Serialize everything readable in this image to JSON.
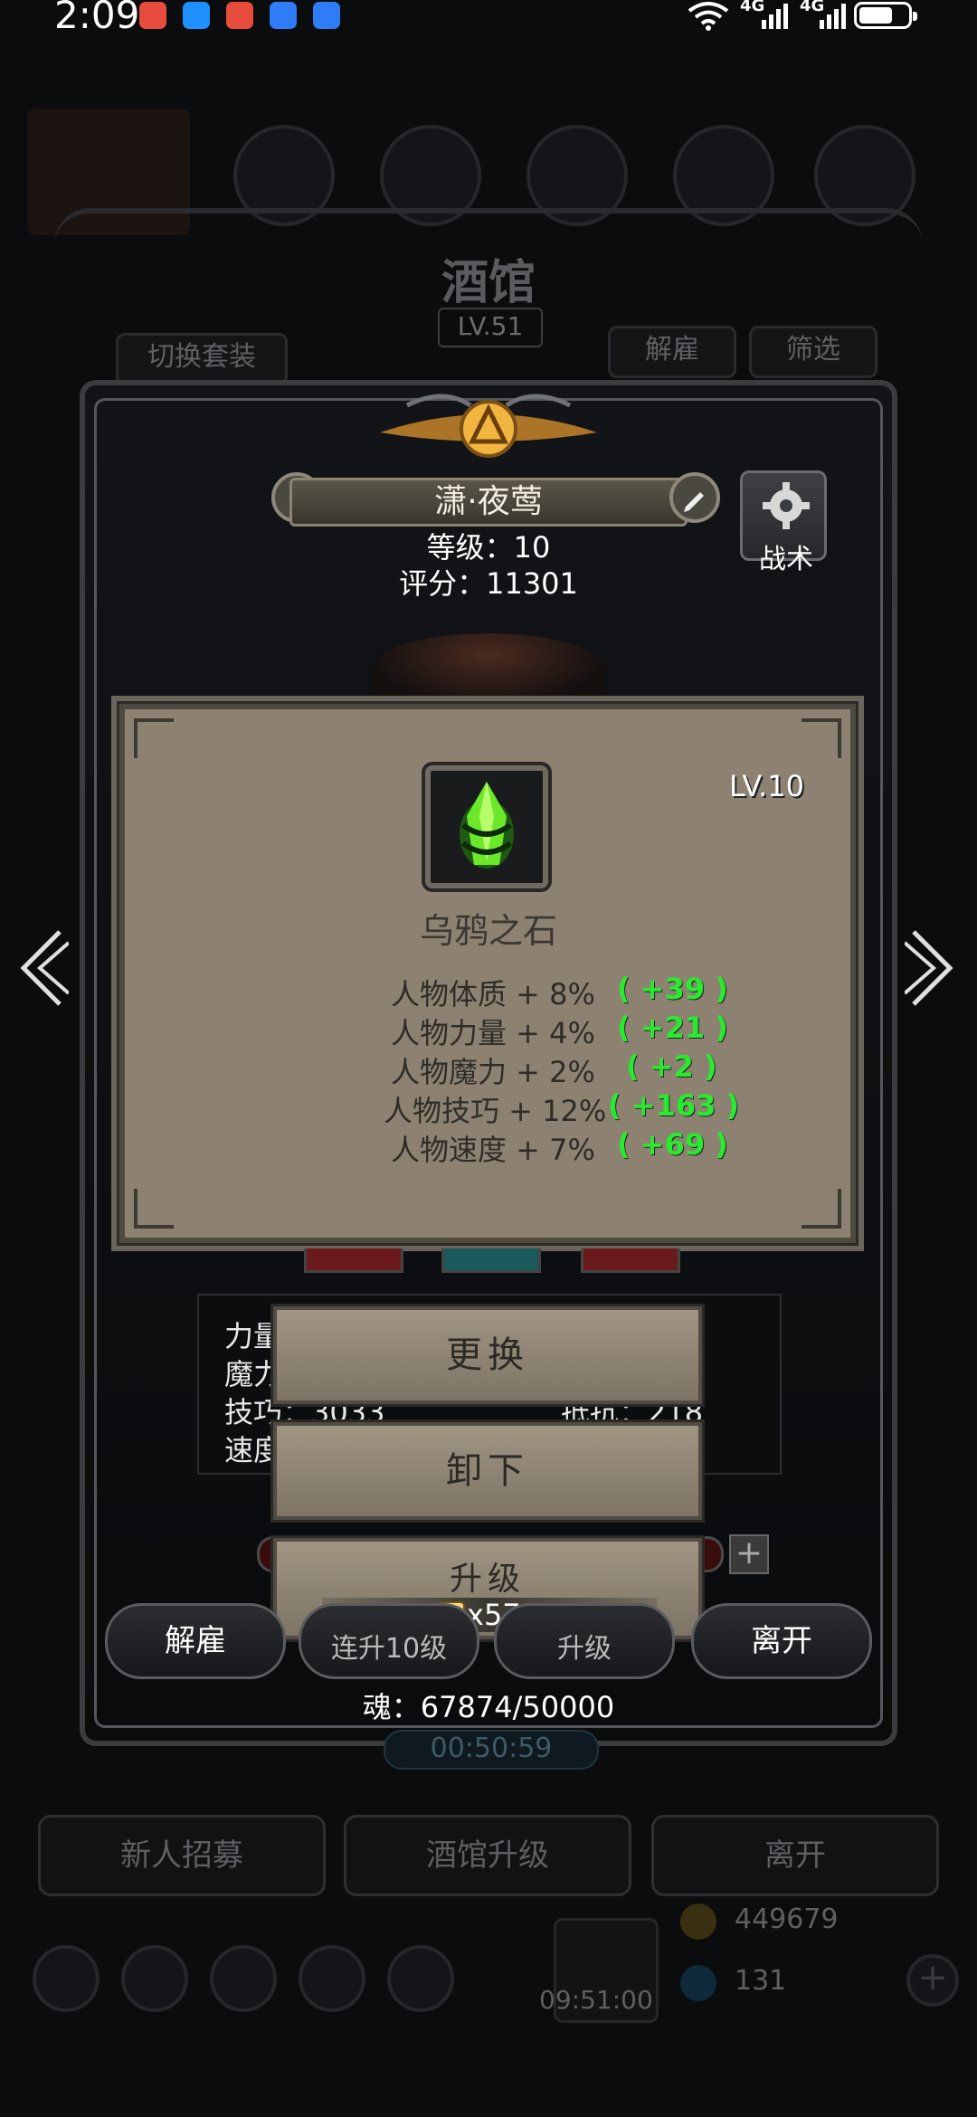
{
  "status_bar": {
    "time": "2:09",
    "signal_labels": [
      "4G",
      "4G"
    ],
    "battery_level": 0.7,
    "app_icon_colors": [
      "#e74c3c",
      "#1e90ff",
      "#e74c3c",
      "#2e7cf6",
      "#2e7cf6"
    ]
  },
  "background": {
    "tavern_title": "酒馆",
    "tavern_level": "LV.51",
    "switch_outfit": "切换套装",
    "dismiss_top": "解雇",
    "filter": "筛选",
    "timer": "00:50:59",
    "bottom_buttons": [
      "新人招募",
      "酒馆升级",
      "离开"
    ],
    "gold": "449679",
    "gems": "131",
    "bottom_timer": "09:51:00"
  },
  "hero": {
    "name": "潇·夜莺",
    "level_text": "等级：10",
    "score_text": "评分：11301",
    "tactics": "战术"
  },
  "item_card": {
    "level": "LV.10",
    "name": "乌鸦之石",
    "stats": [
      {
        "label": "人物体质 + 8%",
        "bonus": "( +39 )"
      },
      {
        "label": "人物力量 + 4%",
        "bonus": "( +21 )"
      },
      {
        "label": "人物魔力 + 2%",
        "bonus": "( +2 )"
      },
      {
        "label": "人物技巧 + 12%",
        "bonus": "( +163 )"
      },
      {
        "label": "人物速度 + 7%",
        "bonus": "( +69 )"
      }
    ]
  },
  "attributes": {
    "lines": [
      "力量",
      "魔力",
      "技巧：3033",
      "速度"
    ],
    "right_partial": "抵抗：218"
  },
  "popup": {
    "replace": "更换",
    "unequip": "卸下",
    "upgrade": "升级",
    "upgrade_cost": "x57000",
    "plus": "+"
  },
  "hero_buttons": {
    "dismiss": "解雇",
    "upgrade10": "连升10级",
    "upgrade": "升级",
    "leave": "离开"
  },
  "soul": "魂：67874/50000"
}
